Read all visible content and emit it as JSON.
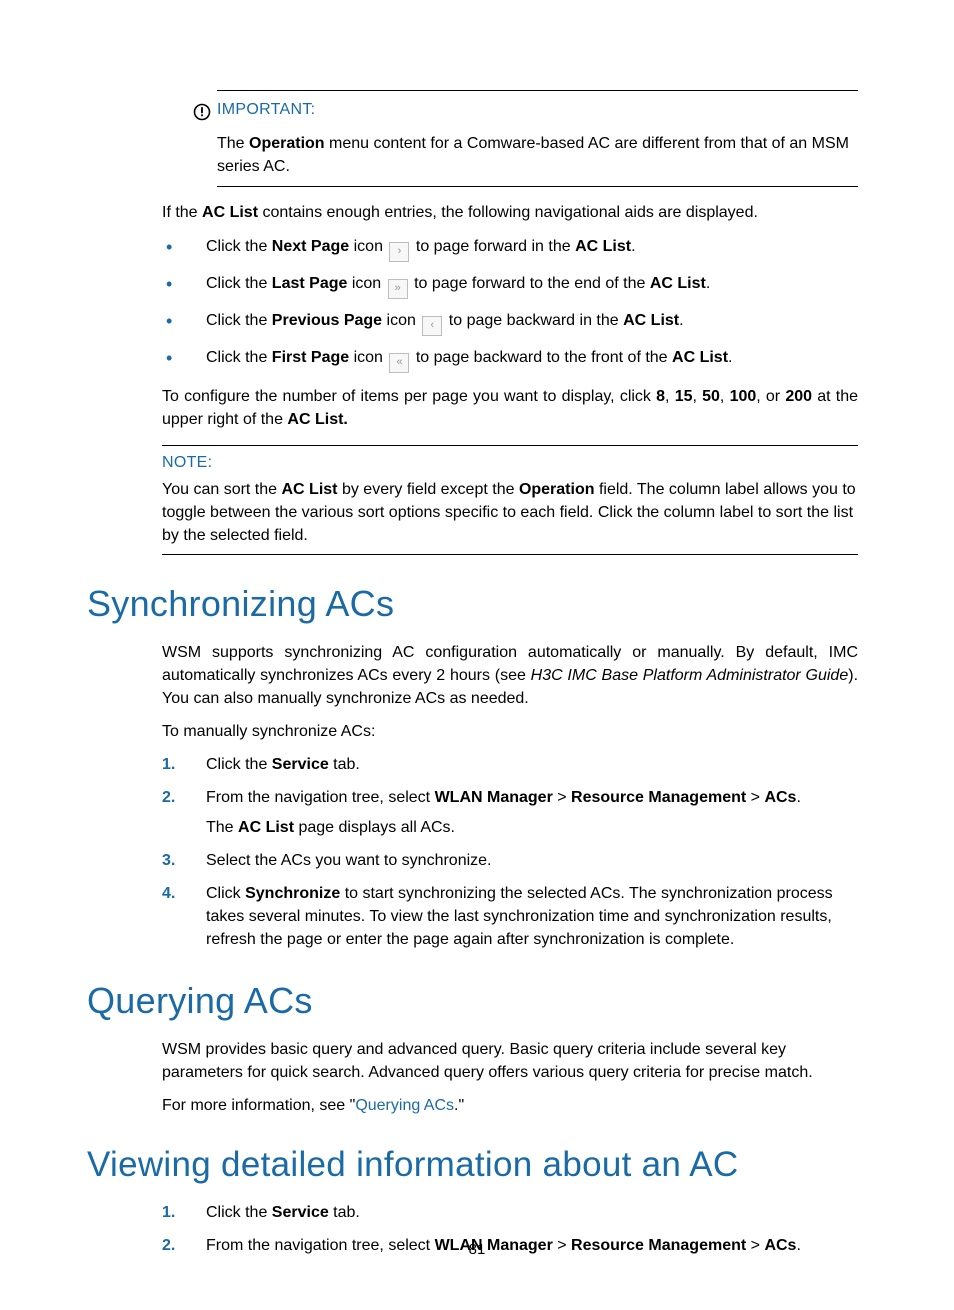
{
  "important": {
    "label": "IMPORTANT:",
    "body_pre": "The ",
    "body_bold1": "Operation",
    "body_rest": " menu content for a Comware-based AC are different from that of an MSM series AC."
  },
  "nav_intro": {
    "pre": "If the ",
    "bold": "AC List",
    "post": " contains enough entries, the following navigational aids are displayed."
  },
  "bullets": [
    {
      "t1": "Click the ",
      "b1": "Next Page",
      "t2": " icon ",
      "glyph": "›",
      "t3": " to page forward in the ",
      "b2": "AC List",
      "t4": "."
    },
    {
      "t1": "Click the ",
      "b1": "Last Page",
      "t2": " icon ",
      "glyph": "»",
      "t3": " to page forward to the end of the ",
      "b2": "AC List",
      "t4": "."
    },
    {
      "t1": "Click the ",
      "b1": "Previous Page",
      "t2": " icon ",
      "glyph": "‹",
      "t3": " to page backward in the ",
      "b2": "AC List",
      "t4": "."
    },
    {
      "t1": "Click the ",
      "b1": "First Page",
      "t2": " icon ",
      "glyph": "«",
      "t3": " to page backward to the front of the ",
      "b2": "AC List",
      "t4": "."
    }
  ],
  "pager_cfg": {
    "pre": "To configure the number of items per page you want to display, click ",
    "n1": "8",
    "n2": "15",
    "n3": "50",
    "n4": "100",
    "n5": "200",
    "mid": " at the upper right of the ",
    "bold": "AC List.",
    "sep": ", ",
    "or": ", or "
  },
  "note": {
    "label": "NOTE:",
    "p1": "You can sort the ",
    "b1": "AC List",
    "p2": " by every field except the ",
    "b2": "Operation",
    "p3": " field. The column label allows you to toggle between the various sort options specific to each field. Click the column label to sort the list by the selected field."
  },
  "sync": {
    "heading": "Synchronizing ACs",
    "intro_p1": "WSM supports synchronizing AC configuration automatically or manually. By default, IMC automatically synchronizes ACs every 2 hours (see ",
    "intro_italic": "H3C IMC Base Platform Administrator Guide",
    "intro_p2": "). You can also manually synchronize ACs as needed.",
    "lead": "To manually synchronize ACs:",
    "steps": [
      {
        "num": "1.",
        "pre": "Click the ",
        "b1": "Service",
        "post": " tab."
      },
      {
        "num": "2.",
        "pre": "From the navigation tree, select ",
        "b1": "WLAN Manager",
        "sep1": " > ",
        "b2": "Resource Management",
        "sep2": " > ",
        "b3": "ACs",
        "post": ".",
        "sub_pre": "The ",
        "sub_b": "AC List",
        "sub_post": " page displays all ACs."
      },
      {
        "num": "3.",
        "text": "Select the ACs you want to synchronize."
      },
      {
        "num": "4.",
        "pre": "Click ",
        "b1": "Synchronize",
        "post": " to start synchronizing the selected ACs. The synchronization process takes several minutes. To view the last synchronization time and synchronization results, refresh the page or enter the page again after synchronization is complete."
      }
    ]
  },
  "query": {
    "heading": "Querying ACs",
    "p1": "WSM provides basic query and advanced query. Basic query criteria include several key parameters for quick search. Advanced query offers various query criteria for precise match.",
    "p2_pre": "For more information, see \"",
    "p2_link": "Querying ACs",
    "p2_post": ".\""
  },
  "viewing": {
    "heading": "Viewing detailed information about an AC",
    "steps": [
      {
        "num": "1.",
        "pre": "Click the ",
        "b1": "Service",
        "post": " tab."
      },
      {
        "num": "2.",
        "pre": "From the navigation tree, select ",
        "b1": "WLAN Manager",
        "sep1": " > ",
        "b2": "Resource Management",
        "sep2": " > ",
        "b3": "ACs",
        "post": "."
      }
    ]
  },
  "page_number": "81"
}
